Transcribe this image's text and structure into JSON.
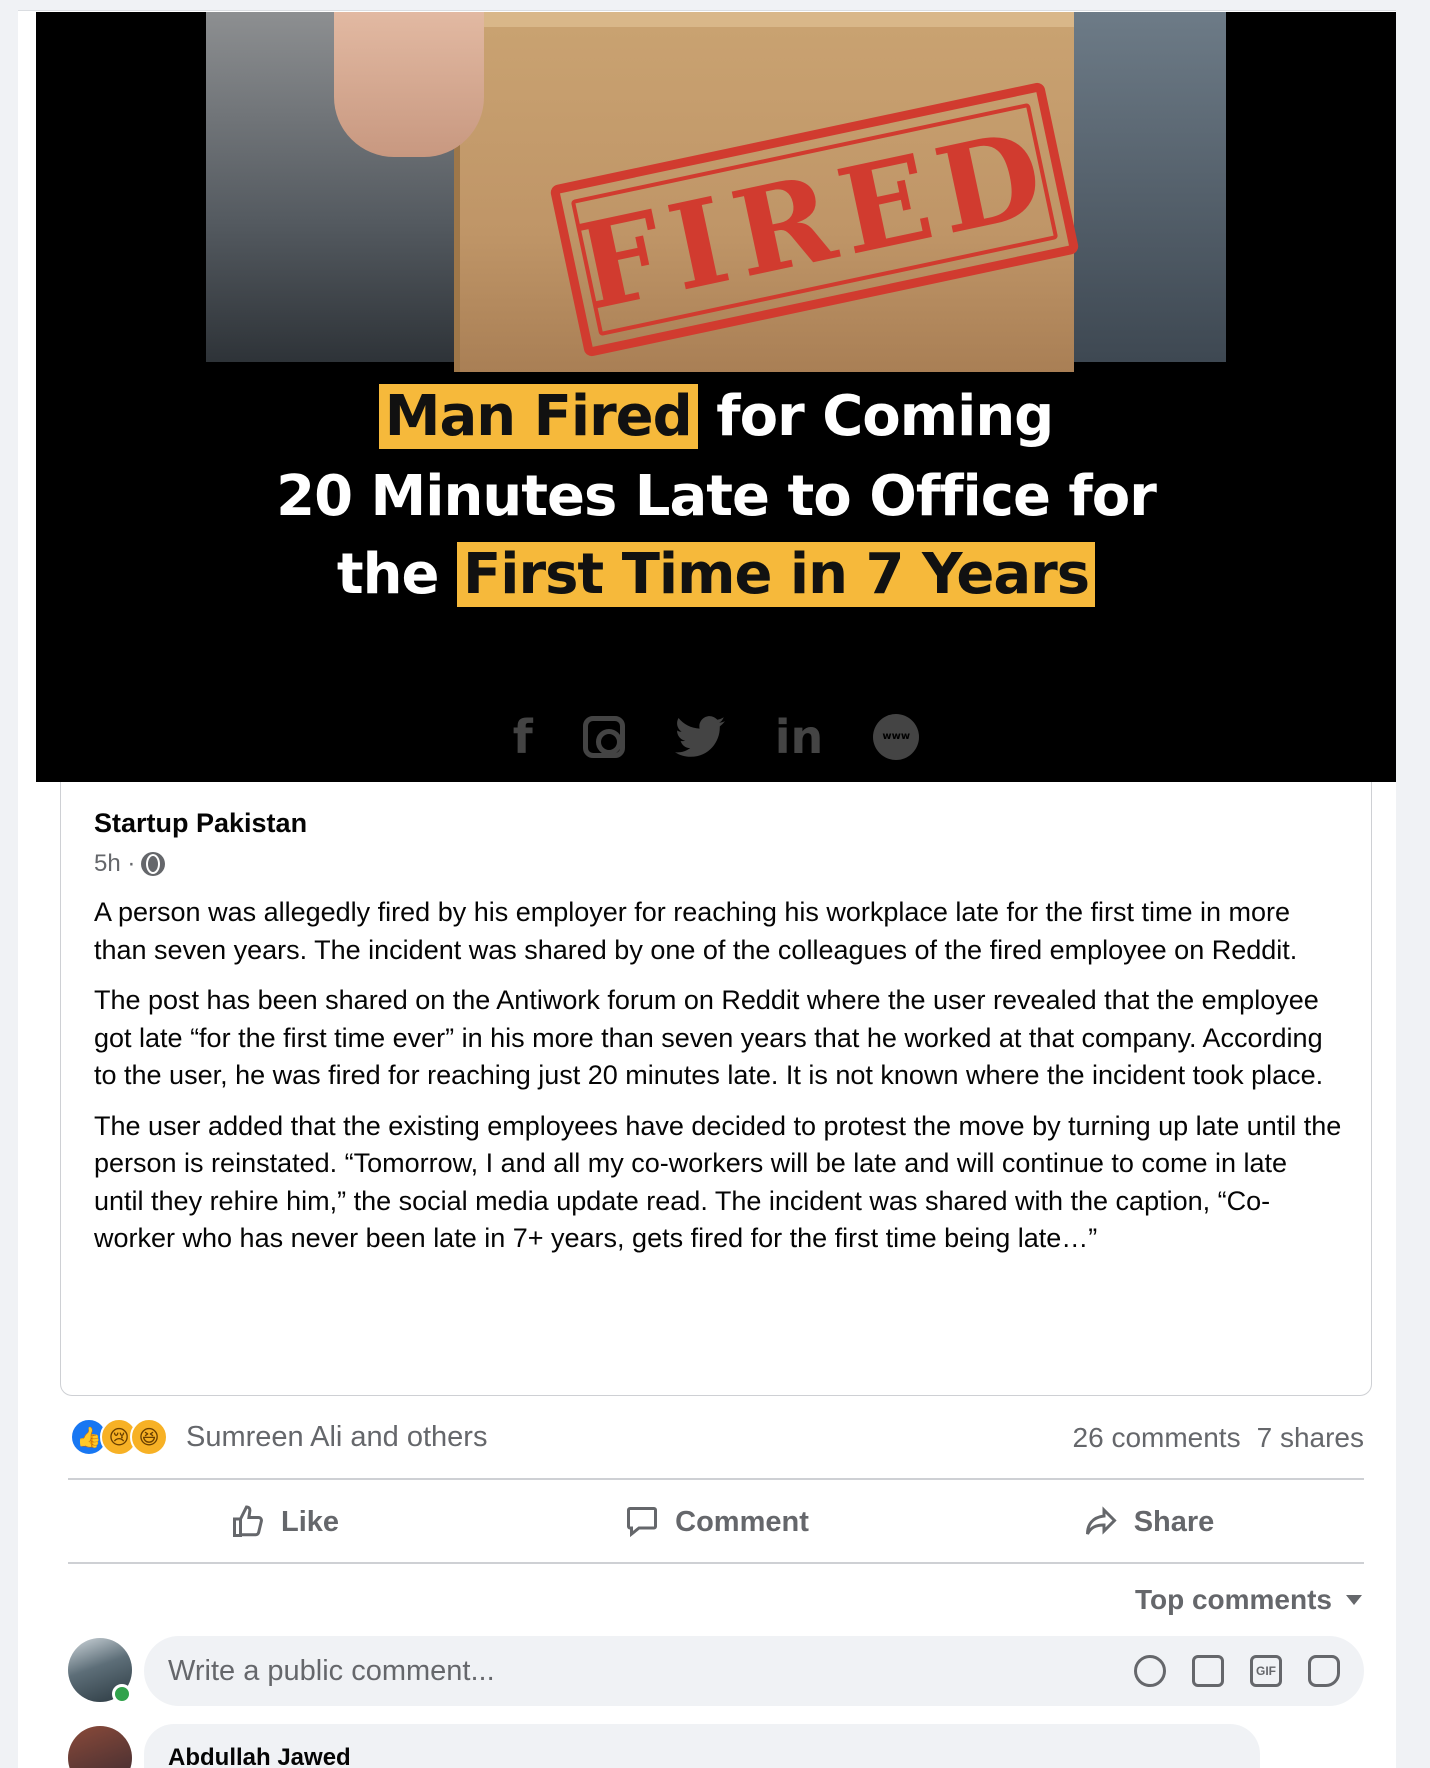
{
  "image": {
    "stamp_text": "FIRED",
    "headline_line1_highlight": "Man Fired",
    "headline_line1_rest": " for Coming",
    "headline_line2": "20 Minutes Late to Office for",
    "headline_line3_plain": "the ",
    "headline_line3_highlight": "First Time in 7 Years",
    "social_icons": [
      "facebook-icon",
      "instagram-icon",
      "twitter-icon",
      "linkedin-icon",
      "www-icon"
    ],
    "social_labels": {
      "facebook": "f",
      "linkedin": "in",
      "www": "www"
    },
    "highlight_color": "#f6b93b",
    "stamp_color": "#d13b2f"
  },
  "post": {
    "author": "Startup Pakistan",
    "time": "5h ·",
    "paragraphs": [
      "A person was allegedly fired by his employer for reaching his workplace late for the first time in more than seven years. The incident was shared by one of the colleagues of the fired employee on Reddit.",
      "The post has been shared on the Antiwork forum on Reddit where the user revealed that the employee got late “for the first time ever” in his more than seven years that he worked at that company. According to the user, he was fired for reaching just 20 minutes late. It is not known where the incident took place.",
      "The user added that the existing employees have decided to protest the move by turning up late until the person is reinstated. “Tomorrow, I and all my co-workers will be late and will continue to come in late until they rehire him,” the social media update read. The incident was shared with the caption, “Co-worker who has never been late in 7+ years, gets fired for the first time being late…”"
    ]
  },
  "reactions": {
    "icons": [
      "like-icon",
      "sad-icon",
      "haha-icon"
    ],
    "summary": "Sumreen Ali and others",
    "comments": "26 comments",
    "shares": "7 shares"
  },
  "actions": {
    "like": "Like",
    "comment": "Comment",
    "share": "Share"
  },
  "comments": {
    "sort_label": "Top comments",
    "placeholder": "Write a public comment...",
    "composer_icons": [
      "emoji-icon",
      "camera-icon",
      "gif-icon",
      "sticker-icon"
    ],
    "gif_label": "GIF",
    "first_commenter": "Abdullah Jawed"
  },
  "colors": {
    "brand_blue": "#1877f2",
    "secondary_text": "#65676b",
    "online": "#31a24c"
  }
}
